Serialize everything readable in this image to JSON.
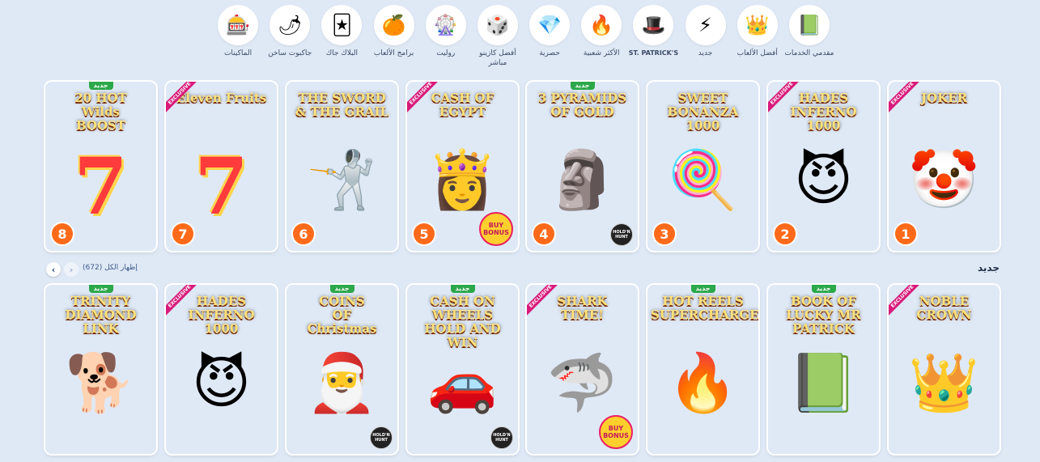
{
  "categories": [
    {
      "label": "مقدمي الخدمات",
      "icon": "book-icon",
      "glyph": "📗",
      "latin": false
    },
    {
      "label": "أفضل الألعاب",
      "icon": "crown-icon",
      "glyph": "👑",
      "latin": false
    },
    {
      "label": "جديد",
      "icon": "lightning-icon",
      "glyph": "⚡",
      "latin": false
    },
    {
      "label": "ST. PATRICK'S",
      "icon": "leprechaun-hat-icon",
      "glyph": "🎩",
      "latin": true
    },
    {
      "label": "الأكثر شعبية",
      "icon": "fire-icon",
      "glyph": "🔥",
      "latin": false
    },
    {
      "label": "حصرية",
      "icon": "diamond-icon",
      "glyph": "💎",
      "latin": false
    },
    {
      "label": "أفضل كازينو مباشر",
      "icon": "dice-icon",
      "glyph": "🎲",
      "latin": false
    },
    {
      "label": "روليت",
      "icon": "roulette-icon",
      "glyph": "🎡",
      "latin": false
    },
    {
      "label": "برامج الألعاب",
      "icon": "orange-slice-icon",
      "glyph": "🍊",
      "latin": false
    },
    {
      "label": "البلاك جاك",
      "icon": "cards-icon",
      "glyph": "🃏",
      "latin": false
    },
    {
      "label": "جاكبوت ساخن",
      "icon": "chili-pepper-icon",
      "glyph": "🌶",
      "latin": false
    },
    {
      "label": "الماكينات",
      "icon": "slot-reel-icon",
      "glyph": "🎰",
      "latin": false
    }
  ],
  "top_games": [
    {
      "title": "20 HOT\nWilds\nBOOST",
      "rank": "8",
      "new": true,
      "exclusive": false,
      "glyph": "7",
      "glyph_type": "text",
      "bg": "linear-gradient(160deg,#6a1fa0,#c0358c 60,#8e1c68)",
      "badge": ""
    },
    {
      "title": "Eleven Fruits",
      "rank": "7",
      "new": false,
      "exclusive": true,
      "glyph": "7",
      "glyph_type": "text",
      "bg": "linear-gradient(160deg,#ff8a1f,#ffb23a 40,#d2451c)",
      "badge": ""
    },
    {
      "title": "THE SWORD\n& THE GRAIL",
      "rank": "6",
      "new": false,
      "exclusive": false,
      "glyph": "🤺",
      "glyph_type": "emoji",
      "bg": "linear-gradient(180deg,#3a2a1c,#6a4a2c 50,#2a1f17)",
      "badge": ""
    },
    {
      "title": "CASH OF\nEGYPT",
      "rank": "5",
      "new": false,
      "exclusive": true,
      "glyph": "👸",
      "glyph_type": "emoji",
      "bg": "linear-gradient(180deg,#1b3a6a,#2f6fa4 45,#e0a64a)",
      "badge": "bonus"
    },
    {
      "title": "3 PYRAMIDS\nOF GOLD",
      "rank": "4",
      "new": true,
      "exclusive": false,
      "glyph": "🗿",
      "glyph_type": "emoji",
      "bg": "linear-gradient(180deg,#3a1f0a,#a8681c 50,#5a2e0c)",
      "badge": "provider"
    },
    {
      "title": "SWEET\nBONANZA\n1000",
      "rank": "3",
      "new": false,
      "exclusive": false,
      "glyph": "🍭",
      "glyph_type": "emoji",
      "bg": "linear-gradient(180deg,#4fb6ff,#ffd0e8 55,#ff7eb6)",
      "badge": ""
    },
    {
      "title": "HADES\nINFERNO\n1000",
      "rank": "2",
      "new": false,
      "exclusive": true,
      "glyph": "😈",
      "glyph_type": "emoji",
      "bg": "linear-gradient(180deg,#8a6ec8,#c484c2 45,#5a3a8a)",
      "badge": ""
    },
    {
      "title": "JOKER",
      "rank": "1",
      "new": false,
      "exclusive": true,
      "glyph": "🤡",
      "glyph_type": "emoji",
      "bg": "linear-gradient(180deg,#1b5a34,#2f8a4a 40,#5a1f7a)",
      "badge": ""
    }
  ],
  "new_section": {
    "title": "جديد",
    "see_all": "إظهار الكل (672)",
    "prev_arrow": "‹",
    "next_arrow": "›"
  },
  "new_games": [
    {
      "title": "TRINITY\nDIAMOND LINK",
      "new": true,
      "exclusive": false,
      "glyph": "🐕",
      "bg": "linear-gradient(180deg,#3a2a8a,#6a4ad0 40,#1a1a3a)",
      "badge": ""
    },
    {
      "title": "HADES\nINFERNO\n1000",
      "new": false,
      "exclusive": true,
      "glyph": "😈",
      "bg": "linear-gradient(180deg,#8a6ec8,#c484c2 45,#5a3a8a)",
      "badge": ""
    },
    {
      "title": "COINS\nOF\nChristmas",
      "new": true,
      "exclusive": false,
      "glyph": "🎅",
      "bg": "linear-gradient(180deg,#0f3a7a,#2a6ad0 45,#0c2a5a)",
      "badge": "provider"
    },
    {
      "title": "CASH ON WHEELS\nHOLD AND WIN",
      "new": true,
      "exclusive": false,
      "glyph": "🚗",
      "bg": "linear-gradient(180deg,#6a0a0a,#b81c1c 45,#3a0505)",
      "badge": "provider"
    },
    {
      "title": "SHARK\nTIME!",
      "new": false,
      "exclusive": true,
      "glyph": "🦈",
      "bg": "linear-gradient(180deg,#0a5aa0,#3fb6e8 50,#0a3a7a)",
      "badge": "bonus"
    },
    {
      "title": "HOT REELS\nSUPERCHARGED",
      "new": true,
      "exclusive": false,
      "glyph": "🔥",
      "bg": "linear-gradient(180deg,#0c1a3a,#14224a 50,#1a0a0a)",
      "badge": ""
    },
    {
      "title": "BOOK OF\nLUCKY MR PATRICK",
      "new": true,
      "exclusive": false,
      "glyph": "📗",
      "bg": "linear-gradient(180deg,#2a5a2a,#6a8a3a 50,#2a3a1a)",
      "badge": ""
    },
    {
      "title": "NOBLE\nCROWN",
      "new": false,
      "exclusive": true,
      "glyph": "👑",
      "bg": "linear-gradient(180deg,#1a6a2a,#3aa84a 45,#0a3a1a)",
      "badge": ""
    }
  ],
  "labels": {
    "new_badge": "جديد",
    "exclusive_ribbon": "EXCLUSIVE",
    "provider_text": "HOLD'N HUNT",
    "bonus_text": "BUY BONUS"
  }
}
